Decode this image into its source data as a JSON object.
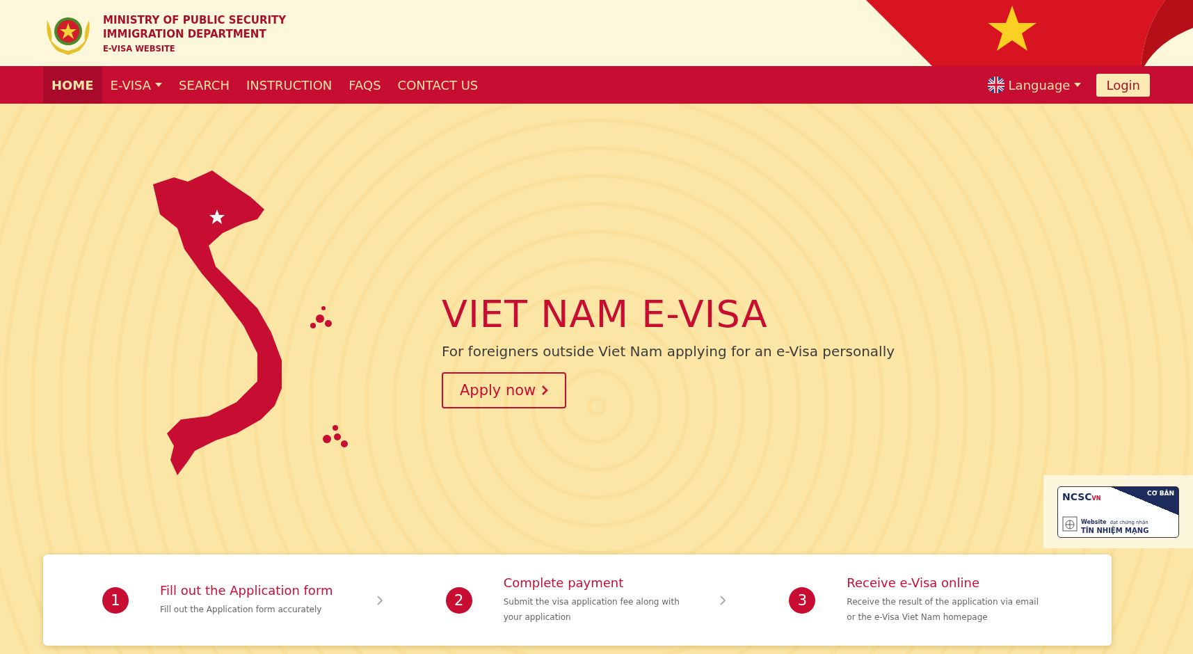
{
  "header": {
    "title_lines": [
      "MINISTRY OF PUBLIC SECURITY",
      "IMMIGRATION DEPARTMENT"
    ],
    "subtitle": "E-VISA WEBSITE"
  },
  "nav": {
    "items": [
      {
        "label": "HOME",
        "selected": true,
        "dropdown": false
      },
      {
        "label": "E-VISA",
        "selected": false,
        "dropdown": true
      },
      {
        "label": "SEARCH",
        "selected": false,
        "dropdown": false
      },
      {
        "label": "INSTRUCTION",
        "selected": false,
        "dropdown": false
      },
      {
        "label": "FAQS",
        "selected": false,
        "dropdown": false
      },
      {
        "label": "CONTACT US",
        "selected": false,
        "dropdown": false
      }
    ],
    "language": "Language",
    "login": "Login"
  },
  "hero": {
    "title": "VIET NAM E-VISA",
    "subtitle": "For foreigners outside Viet Nam applying for an e-Visa personally",
    "button": "Apply now"
  },
  "steps": [
    {
      "number": "1",
      "title": "Fill out the Application form",
      "text": "Fill out the Application form accurately"
    },
    {
      "number": "2",
      "title": "Complete payment",
      "text": "Submit the visa application fee along with your application"
    },
    {
      "number": "3",
      "title": "Receive e-Visa online",
      "text": "Receive the result of the application via email or the e-Visa Viet Nam homepage"
    }
  ],
  "badge": {
    "brand": "NCSC",
    "brand_suffix": "VN",
    "level": "CƠ BẢN",
    "line1": "Website",
    "line1_suffix": "đạt chứng nhận",
    "line2": "TÍN NHIỆM MẠNG"
  }
}
